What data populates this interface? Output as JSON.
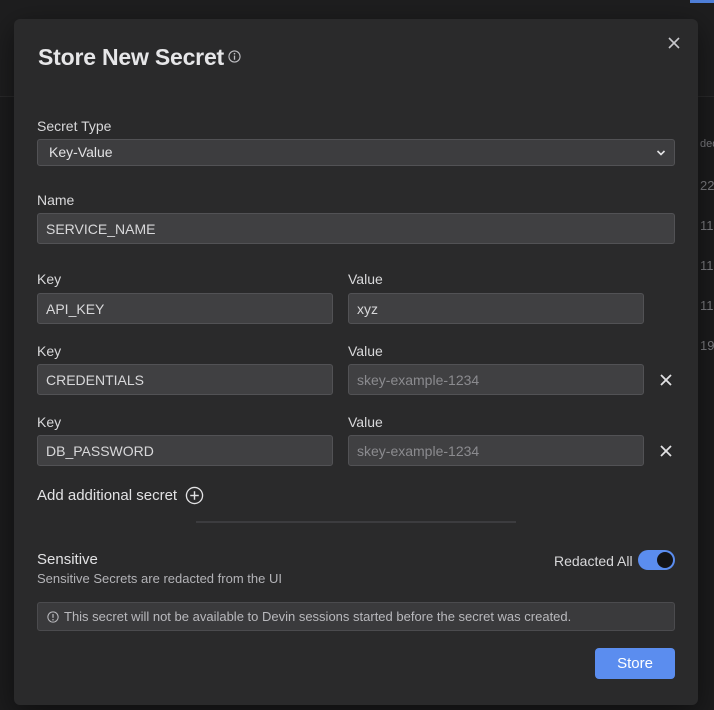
{
  "modal": {
    "title": "Store New Secret",
    "secret_type_label": "Secret Type",
    "secret_type_value": "Key-Value",
    "name_label": "Name",
    "name_value": "SERVICE_NAME",
    "pairs": [
      {
        "key_label": "Key",
        "value_label": "Value",
        "key": "API_KEY",
        "value": "xyz",
        "value_placeholder": "",
        "removable": false
      },
      {
        "key_label": "Key",
        "value_label": "Value",
        "key": "CREDENTIALS",
        "value": "",
        "value_placeholder": "skey-example-1234",
        "removable": true
      },
      {
        "key_label": "Key",
        "value_label": "Value",
        "key": "DB_PASSWORD",
        "value": "",
        "value_placeholder": "skey-example-1234",
        "removable": true
      }
    ],
    "add_secret_label": "Add additional secret",
    "sensitive_title": "Sensitive",
    "sensitive_description": "Sensitive Secrets are redacted from the UI",
    "redacted_label": "Redacted All",
    "redacted_on": true,
    "notice": "This secret will not be available to Devin sessions started before the secret was created.",
    "store_label": "Store"
  },
  "background": {
    "column_header_fragment": "ded",
    "row_fragments": [
      "22",
      "11",
      "11",
      "11",
      "19"
    ]
  },
  "colors": {
    "accent": "#5b8def",
    "modal_bg": "#2a2a2b",
    "field_bg": "#404042"
  }
}
